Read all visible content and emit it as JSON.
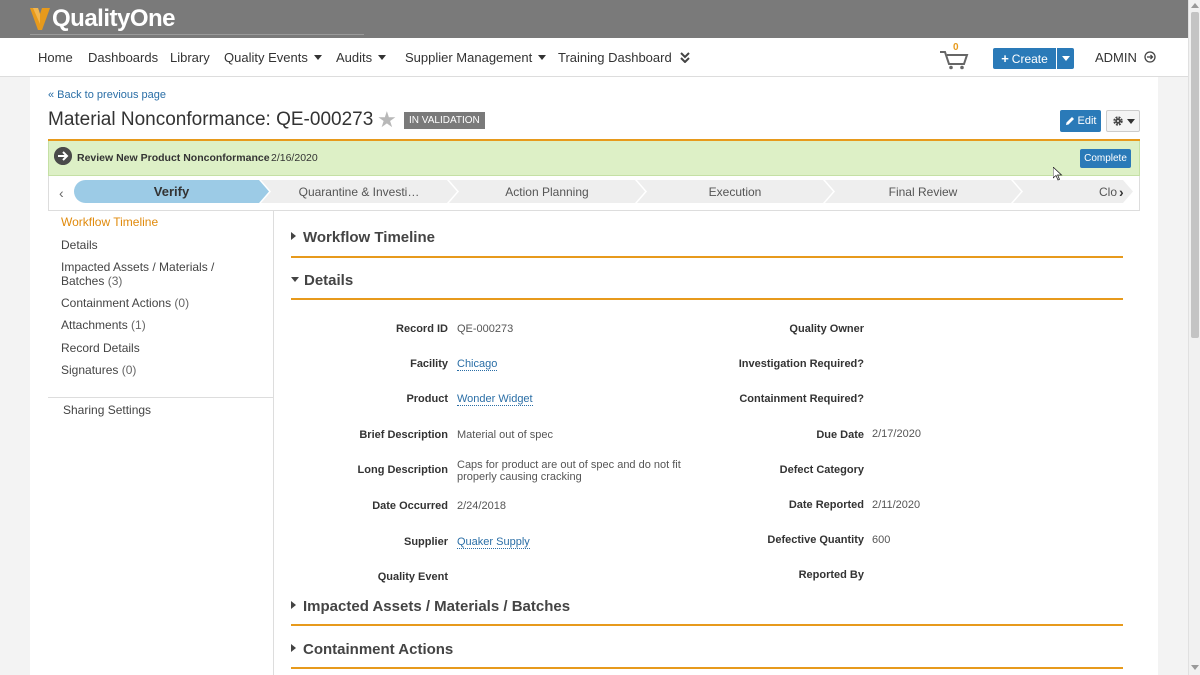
{
  "app": {
    "brand": "QualityOne",
    "brand_color": "#e79a1c"
  },
  "nav": {
    "items": [
      {
        "label": "Home",
        "dropdown": false
      },
      {
        "label": "Dashboards",
        "dropdown": false
      },
      {
        "label": "Library",
        "dropdown": false
      },
      {
        "label": "Quality Events",
        "dropdown": true
      },
      {
        "label": "Audits",
        "dropdown": true
      },
      {
        "label": "Supplier Management",
        "dropdown": true
      },
      {
        "label": "Training Dashboard",
        "dropdown": false
      }
    ],
    "more_icon": "double-chevron-down-icon",
    "cart_count": "0",
    "create_label": "Create",
    "user_label": "ADMIN"
  },
  "header": {
    "back_link": "« Back to previous page",
    "title": "Material Nonconformance: QE-000273",
    "status": "IN VALIDATION",
    "edit_label": "Edit"
  },
  "task": {
    "label": "Review New Product Nonconformance",
    "date": "2/16/2020",
    "complete_label": "Complete"
  },
  "stages": [
    {
      "label": "Verify",
      "active": true
    },
    {
      "label": "Quarantine & Investi…",
      "active": false
    },
    {
      "label": "Action Planning",
      "active": false
    },
    {
      "label": "Execution",
      "active": false
    },
    {
      "label": "Final Review",
      "active": false
    },
    {
      "label": "Clo",
      "active": false
    }
  ],
  "left_nav": {
    "items": [
      {
        "label": "Workflow Timeline",
        "count": "",
        "active": true
      },
      {
        "label": "Details",
        "count": "",
        "active": false
      },
      {
        "label": "Impacted Assets / Materials /",
        "label2": "Batches",
        "count": "(3)",
        "active": false
      },
      {
        "label": "Containment Actions",
        "count": "(0)",
        "active": false
      },
      {
        "label": "Attachments",
        "count": "(1)",
        "active": false
      },
      {
        "label": "Record Details",
        "count": "",
        "active": false
      },
      {
        "label": "Signatures",
        "count": "(0)",
        "active": false
      }
    ],
    "sharing": "Sharing Settings"
  },
  "sections": {
    "workflow_timeline": "Workflow Timeline",
    "details": "Details",
    "impacted": "Impacted Assets / Materials / Batches",
    "containment": "Containment Actions"
  },
  "details": {
    "left": [
      {
        "label": "Record ID",
        "value": "QE-000273",
        "link": false
      },
      {
        "label": "Facility",
        "value": "Chicago",
        "link": true
      },
      {
        "label": "Product",
        "value": "Wonder Widget",
        "link": true
      },
      {
        "label": "Brief Description",
        "value": "Material out of spec",
        "link": false
      },
      {
        "label": "Long Description",
        "value": "Caps for product are out of spec and do not fit properly causing cracking",
        "link": false
      },
      {
        "label": "Date Occurred",
        "value": "2/24/2018",
        "link": false
      },
      {
        "label": "Supplier",
        "value": "Quaker Supply",
        "link": true
      },
      {
        "label": "Quality Event",
        "value": "",
        "link": false
      }
    ],
    "right": [
      {
        "label": "Quality Owner",
        "value": ""
      },
      {
        "label": "Investigation Required?",
        "value": ""
      },
      {
        "label": "Containment Required?",
        "value": ""
      },
      {
        "label": "Due Date",
        "value": "2/17/2020"
      },
      {
        "label": "Defect Category",
        "value": ""
      },
      {
        "label": "Date Reported",
        "value": "2/11/2020"
      },
      {
        "label": "Defective Quantity",
        "value": "600"
      },
      {
        "label": "Reported By",
        "value": ""
      }
    ]
  }
}
